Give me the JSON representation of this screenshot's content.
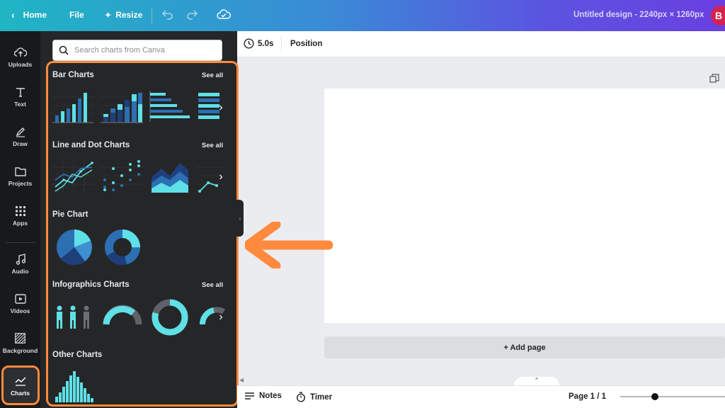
{
  "topbar": {
    "home_label": "Home",
    "file_label": "File",
    "resize_label": "Resize",
    "design_title": "Untitled design - 2240px × 1260px",
    "avatar_initial": "B"
  },
  "rail": {
    "items": [
      {
        "label": "Uploads",
        "icon": "upload-cloud-icon"
      },
      {
        "label": "Text",
        "icon": "text-T-icon"
      },
      {
        "label": "Draw",
        "icon": "pen-icon"
      },
      {
        "label": "Projects",
        "icon": "folder-icon"
      },
      {
        "label": "Apps",
        "icon": "grid-icon"
      },
      {
        "label": "Audio",
        "icon": "music-note-icon"
      },
      {
        "label": "Videos",
        "icon": "video-icon"
      },
      {
        "label": "Background",
        "icon": "hatch-icon"
      },
      {
        "label": "Charts",
        "icon": "chart-line-icon",
        "active": true
      }
    ]
  },
  "panel": {
    "search_placeholder": "Search charts from Canva",
    "sections": [
      {
        "title": "Bar Charts",
        "see_all": "See all"
      },
      {
        "title": "Line and Dot Charts",
        "see_all": "See all"
      },
      {
        "title": "Pie Chart",
        "see_all": ""
      },
      {
        "title": "Infographics Charts",
        "see_all": "See all"
      },
      {
        "title": "Other Charts",
        "see_all": ""
      }
    ]
  },
  "canvas": {
    "duration": "5.0s",
    "position_label": "Position",
    "add_page_label": "+ Add page"
  },
  "bottombar": {
    "notes_label": "Notes",
    "timer_label": "Timer",
    "page_indicator": "Page 1 / 1",
    "zoom_fraction": 0.3
  },
  "colors": {
    "accent_orange": "#ff8a3d",
    "chart_cyan": "#5ee0e6",
    "chart_blue": "#2c6fb3",
    "chart_navy": "#1e3f7a"
  }
}
